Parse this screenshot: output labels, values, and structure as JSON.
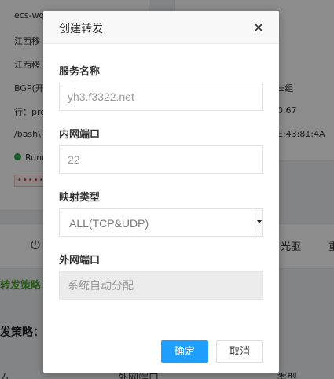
{
  "background": {
    "left_lines": [
      "ecs-wq",
      "江西移",
      "江西移",
      "BGP(开",
      "行：pro",
      "/bash\\",
      "Runn"
    ],
    "right_lines": [
      "±组",
      "0.67",
      "E:43:81:4A"
    ],
    "password_mask": "••••••",
    "right_band_texts": [
      "光驱",
      "重"
    ],
    "green_tab": "转发策略",
    "strategy_label": "发策略：",
    "table_headers": [
      "ㄙ",
      "外网端口",
      "类型"
    ]
  },
  "dialog": {
    "title": "创建转发",
    "fields": {
      "service_name": {
        "label": "服务名称",
        "placeholder": "yh3.f3322.net"
      },
      "internal_port": {
        "label": "内网端口",
        "placeholder": "22"
      },
      "mapping_type": {
        "label": "映射类型",
        "value": "ALL(TCP&UDP)"
      },
      "external_port": {
        "label": "外网端口",
        "placeholder": "系统自动分配"
      }
    },
    "confirm_label": "确定",
    "cancel_label": "取消"
  },
  "colors": {
    "primary": "#1e9fff",
    "overlay": "rgba(0,0,0,0.45)",
    "running_green": "#2ea44f",
    "tab_green": "#4a9d2e"
  }
}
